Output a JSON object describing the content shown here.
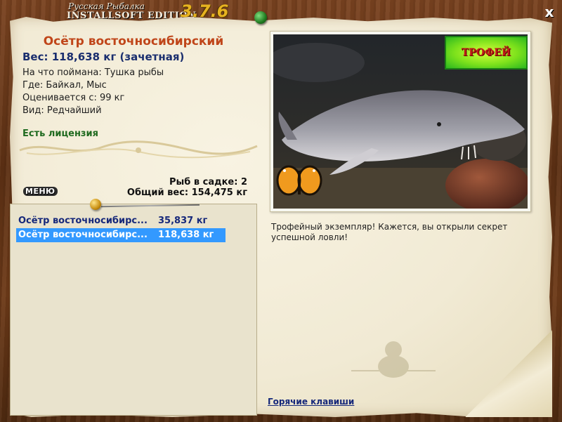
{
  "window": {
    "title_small": "Русская Рыбалка",
    "title_big": "INSTALLSOFT EDITION",
    "version": "3.7.6",
    "close_label": "x"
  },
  "fish": {
    "name": "Осётр восточносибирский",
    "weight_line": "Вес: 118,638 кг (зачетная)",
    "bait_line": "На что поймана: Тушка рыбы",
    "location_line": "Где: Байкал, Мыс",
    "rated_line": "Оценивается с: 99 кг",
    "kind_line": "Вид: Редчайший",
    "license": "Есть лицензия"
  },
  "summary": {
    "fish_count": "Рыб в садке: 2",
    "total_weight": "Общий вес: 154,475 кг"
  },
  "menu_label": "МЕНЮ",
  "cage": {
    "rows": [
      {
        "name": "Осётр восточносибирс...",
        "weight": "35,837 кг",
        "selected": false
      },
      {
        "name": "Осётр восточносибирс...",
        "weight": "118,638 кг",
        "selected": true
      }
    ]
  },
  "photo": {
    "badge": "ТРОФЕЙ"
  },
  "description": "Трофейный экземпляр! Кажется, вы открыли секрет успешной ловли!",
  "hotkeys_label": "Горячие клавиши",
  "colors": {
    "fish_name": "#c0461a",
    "weight": "#1a2e6e",
    "license": "#1f6a1f",
    "selected_row": "#3399ff",
    "version": "#e7b320"
  }
}
